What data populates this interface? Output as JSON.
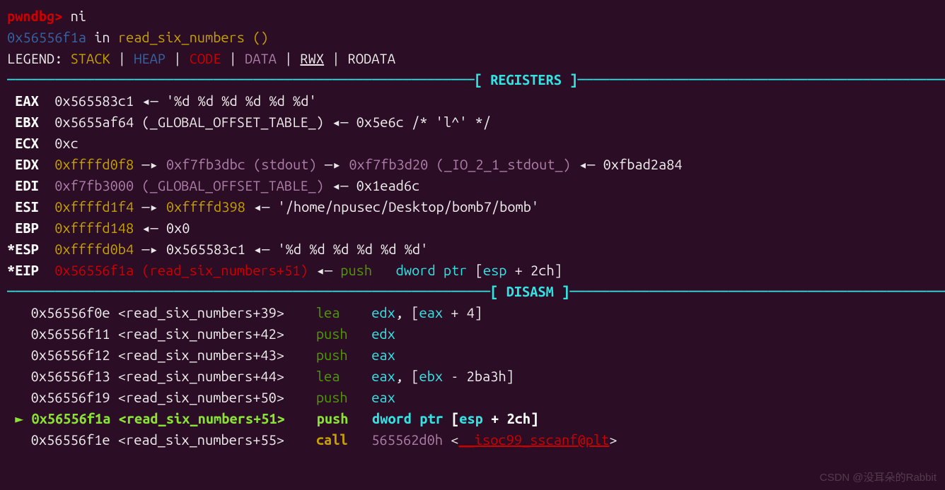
{
  "prompt": {
    "label": "pwndbg>",
    "cmd": "ni"
  },
  "status_line": {
    "addr": "0x56556f1a",
    "in": " in ",
    "func": "read_six_numbers ()"
  },
  "legend": {
    "label": "LEGEND: ",
    "stack": "STACK",
    "heap": "HEAP",
    "code": "CODE",
    "data": "DATA",
    "rwx": "RWX",
    "rodata": "RODATA",
    "sep": " | "
  },
  "sections": {
    "registers": "REGISTERS",
    "disasm": "DISASM"
  },
  "registers": {
    "eax": {
      "name": " EAX  ",
      "addr": "0x565583c1",
      "arrow": " ◂— ",
      "val": "'%d %d %d %d %d %d'"
    },
    "ebx": {
      "name": " EBX  ",
      "addr": "0x5655af64",
      "note": " (_GLOBAL_OFFSET_TABLE_)",
      "arrow": " ◂— ",
      "val": "0x5e6c /* 'l^' */"
    },
    "ecx": {
      "name": " ECX  ",
      "addr": "0xc"
    },
    "edx": {
      "name": " EDX  ",
      "addr": "0xffffd0f8",
      "a1": " —▸ ",
      "p1": "0xf7fb3dbc (stdout)",
      "a2": " —▸ ",
      "p2": "0xf7fb3d20 (_IO_2_1_stdout_)",
      "a3": " ◂— ",
      "p3": "0xfbad2a84"
    },
    "edi": {
      "name": " EDI  ",
      "addr": "0xf7fb3000 (_GLOBAL_OFFSET_TABLE_)",
      "arrow": " ◂— ",
      "val": "0x1ead6c"
    },
    "esi": {
      "name": " ESI  ",
      "addr": "0xffffd1f4",
      "a1": " —▸ ",
      "p1": "0xffffd398",
      "a2": " ◂— ",
      "p2": "'/home/npusec/Desktop/bomb7/bomb'"
    },
    "ebp": {
      "name": " EBP  ",
      "addr": "0xffffd148",
      "arrow": " ◂— ",
      "val": "0x0"
    },
    "esp": {
      "name": "*ESP  ",
      "addr": "0xffffd0b4",
      "a1": " —▸ ",
      "p1": "0x565583c1",
      "a2": " ◂— ",
      "p2": "'%d %d %d %d %d %d'"
    },
    "eip": {
      "name": "*EIP  ",
      "addr": "0x56556f1a (read_six_numbers+51)",
      "arrow": " ◂— ",
      "mnem": "push   ",
      "op1": "dword ptr ",
      "br1": "[",
      "reg": "esp",
      "plus": " + ",
      "off": "2ch",
      "br2": "]"
    }
  },
  "disasm": {
    "l1": {
      "addr": "   0x56556f0e",
      "sym": " <read_six_numbers+39>    ",
      "mnem": "lea    ",
      "op": "edx",
      "c1": ", [",
      "r2": "eax",
      "plus": " + ",
      "off": "4",
      "c2": "]"
    },
    "l2": {
      "addr": "   0x56556f11",
      "sym": " <read_six_numbers+42>    ",
      "mnem": "push   ",
      "op": "edx"
    },
    "l3": {
      "addr": "   0x56556f12",
      "sym": " <read_six_numbers+43>    ",
      "mnem": "push   ",
      "op": "eax"
    },
    "l4": {
      "addr": "   0x56556f13",
      "sym": " <read_six_numbers+44>    ",
      "mnem": "lea    ",
      "op": "eax",
      "c1": ", [",
      "r2": "ebx",
      "plus": " - ",
      "off": "2ba3h",
      "c2": "]"
    },
    "l5": {
      "addr": "   0x56556f19",
      "sym": " <read_six_numbers+50>    ",
      "mnem": "push   ",
      "op": "eax"
    },
    "l6": {
      "mark": " ► ",
      "addr": "0x56556f1a",
      "sym": " <read_six_numbers+51>    ",
      "mnem": "push   ",
      "op1": "dword ptr ",
      "br1": "[",
      "reg": "esp",
      "plus": " + ",
      "off": "2ch",
      "br2": "]"
    },
    "l7": {
      "addr": "   0x56556f1e",
      "sym": " <read_six_numbers+55>    ",
      "mnem": "call   ",
      "tgt": "565562d0h",
      "lt": " <",
      "fn": "__isoc99_sscanf@plt",
      "gt": ">"
    }
  },
  "watermark": "CSDN @没耳朵的Rabbit"
}
